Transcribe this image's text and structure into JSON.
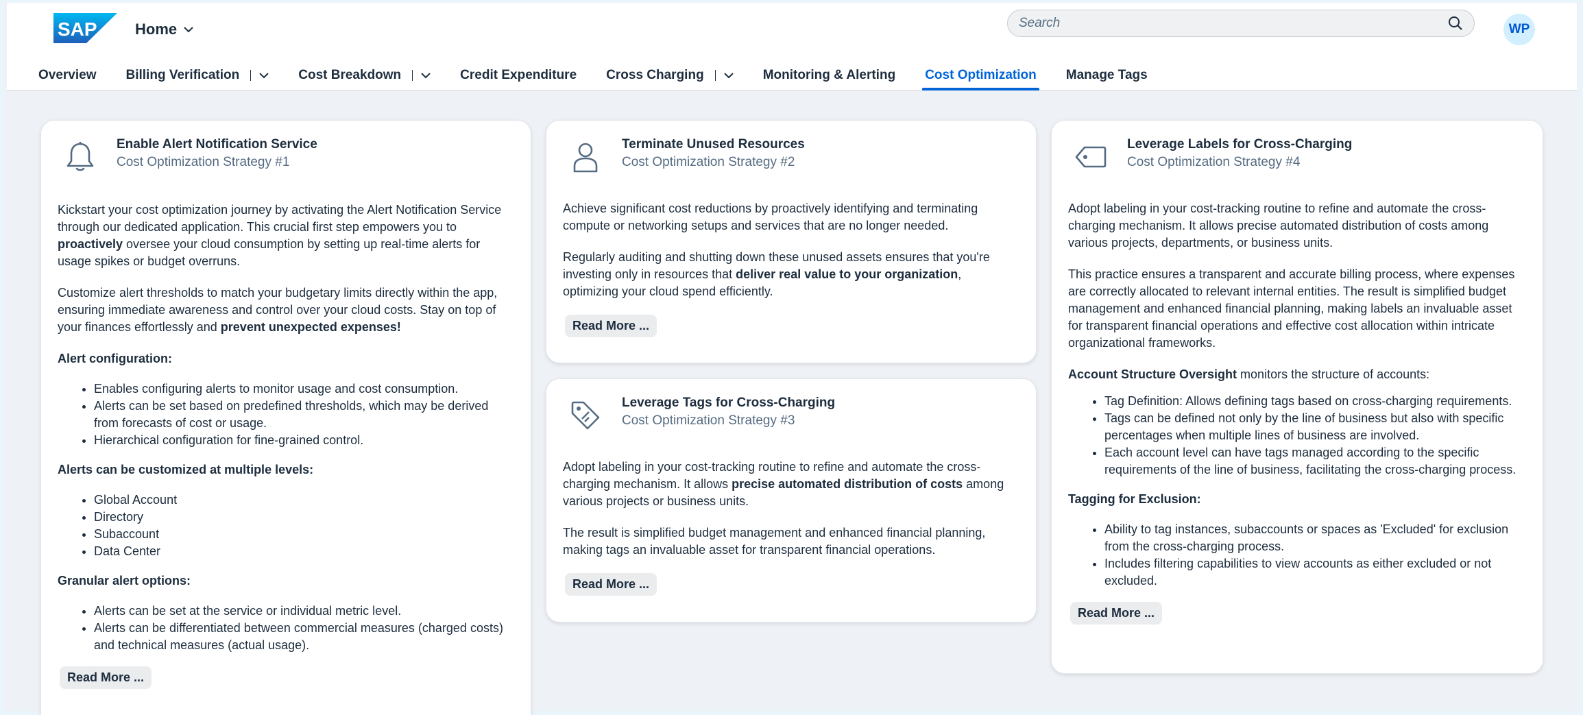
{
  "header": {
    "logo_text": "SAP",
    "home_label": "Home",
    "search_placeholder": "Search",
    "avatar_initials": "WP"
  },
  "tabs": [
    {
      "label": "Overview",
      "dropdown": false
    },
    {
      "label": "Billing Verification",
      "dropdown": true
    },
    {
      "label": "Cost Breakdown",
      "dropdown": true
    },
    {
      "label": "Credit Expenditure",
      "dropdown": false
    },
    {
      "label": "Cross Charging",
      "dropdown": true
    },
    {
      "label": "Monitoring & Alerting",
      "dropdown": false
    },
    {
      "label": "Cost Optimization",
      "dropdown": false,
      "active": true
    },
    {
      "label": "Manage Tags",
      "dropdown": false
    }
  ],
  "cards": {
    "alert": {
      "icon": "bell-icon",
      "title": "Enable Alert Notification Service",
      "subtitle": "Cost Optimization Strategy #1",
      "p1_a": "Kickstart your cost optimization journey by activating the Alert Notification Service through our dedicated application. This crucial first step empowers you to ",
      "p1_b": "proactively",
      "p1_c": " oversee your cloud consumption by setting up real-time alerts for usage spikes or budget overruns.",
      "p2_a": "Customize alert thresholds to match your budgetary limits directly within the app, ensuring immediate awareness and control over your cloud costs. Stay on top of your finances effortlessly and ",
      "p2_b": "prevent unexpected expenses!",
      "h1": "Alert configuration:",
      "list1": [
        "Enables configuring alerts to monitor usage and cost consumption.",
        "Alerts can be set based on predefined thresholds, which may be derived from forecasts of cost or usage.",
        "Hierarchical configuration for fine-grained control."
      ],
      "h2": "Alerts can be customized at multiple levels:",
      "list2": [
        "Global Account",
        "Directory",
        "Subaccount",
        "Data Center"
      ],
      "h3": "Granular alert options:",
      "list3": [
        "Alerts can be set at the service or individual metric level.",
        "Alerts can be differentiated between commercial measures (charged costs) and technical measures (actual usage)."
      ],
      "read_more": "Read More ..."
    },
    "terminate": {
      "icon": "person-icon",
      "title": "Terminate Unused Resources",
      "subtitle": "Cost Optimization Strategy #2",
      "p1": "Achieve significant cost reductions by proactively identifying and terminating compute or networking setups and services that are no longer needed.",
      "p2_a": "Regularly auditing and shutting down these unused assets ensures that you're investing only in resources that ",
      "p2_b": "deliver real value to your organization",
      "p2_c": ", optimizing your cloud spend efficiently.",
      "read_more": "Read More ..."
    },
    "tags": {
      "icon": "tag-icon",
      "title": "Leverage Tags for Cross-Charging",
      "subtitle": "Cost Optimization Strategy #3",
      "p1_a": "Adopt labeling in your cost-tracking routine to refine and automate the cross-charging mechanism. It allows ",
      "p1_b": "precise automated distribution of costs",
      "p1_c": " among various projects or business units.",
      "p2": "The result is simplified budget management and enhanced financial planning, making tags an invaluable asset for transparent financial operations.",
      "read_more": "Read More ..."
    },
    "labels": {
      "icon": "label-icon",
      "title": "Leverage Labels for Cross-Charging",
      "subtitle": "Cost Optimization Strategy #4",
      "p1": "Adopt labeling in your cost-tracking routine to refine and automate the cross-charging mechanism. It allows precise automated distribution of costs among various projects, departments, or business units.",
      "p2": "This practice ensures a transparent and accurate billing process, where expenses are correctly allocated to relevant internal entities. The result is simplified budget management and enhanced financial planning, making labels an invaluable asset for transparent financial operations and effective cost allocation within intricate organizational frameworks.",
      "p3_a": "Account Structure Oversight",
      "p3_b": " monitors the structure of accounts:",
      "list1": [
        "Tag Definition: Allows defining tags based on cross-charging requirements.",
        "Tags can be defined not only by the line of business but also with specific percentages when multiple lines of business are involved.",
        "Each account level can have tags managed according to the specific requirements of the line of business, facilitating the cross-charging process."
      ],
      "h2": "Tagging for Exclusion:",
      "list2": [
        "Ability to tag instances, subaccounts or spaces as 'Excluded' for exclusion from the cross-charging process.",
        "Includes filtering capabilities to view accounts as either excluded or not excluded."
      ],
      "read_more": "Read More ..."
    }
  },
  "colors": {
    "brand": "#0070f2",
    "active_tab": "#0064d9",
    "background": "#eef1f5",
    "avatar_bg": "#d1efff"
  }
}
